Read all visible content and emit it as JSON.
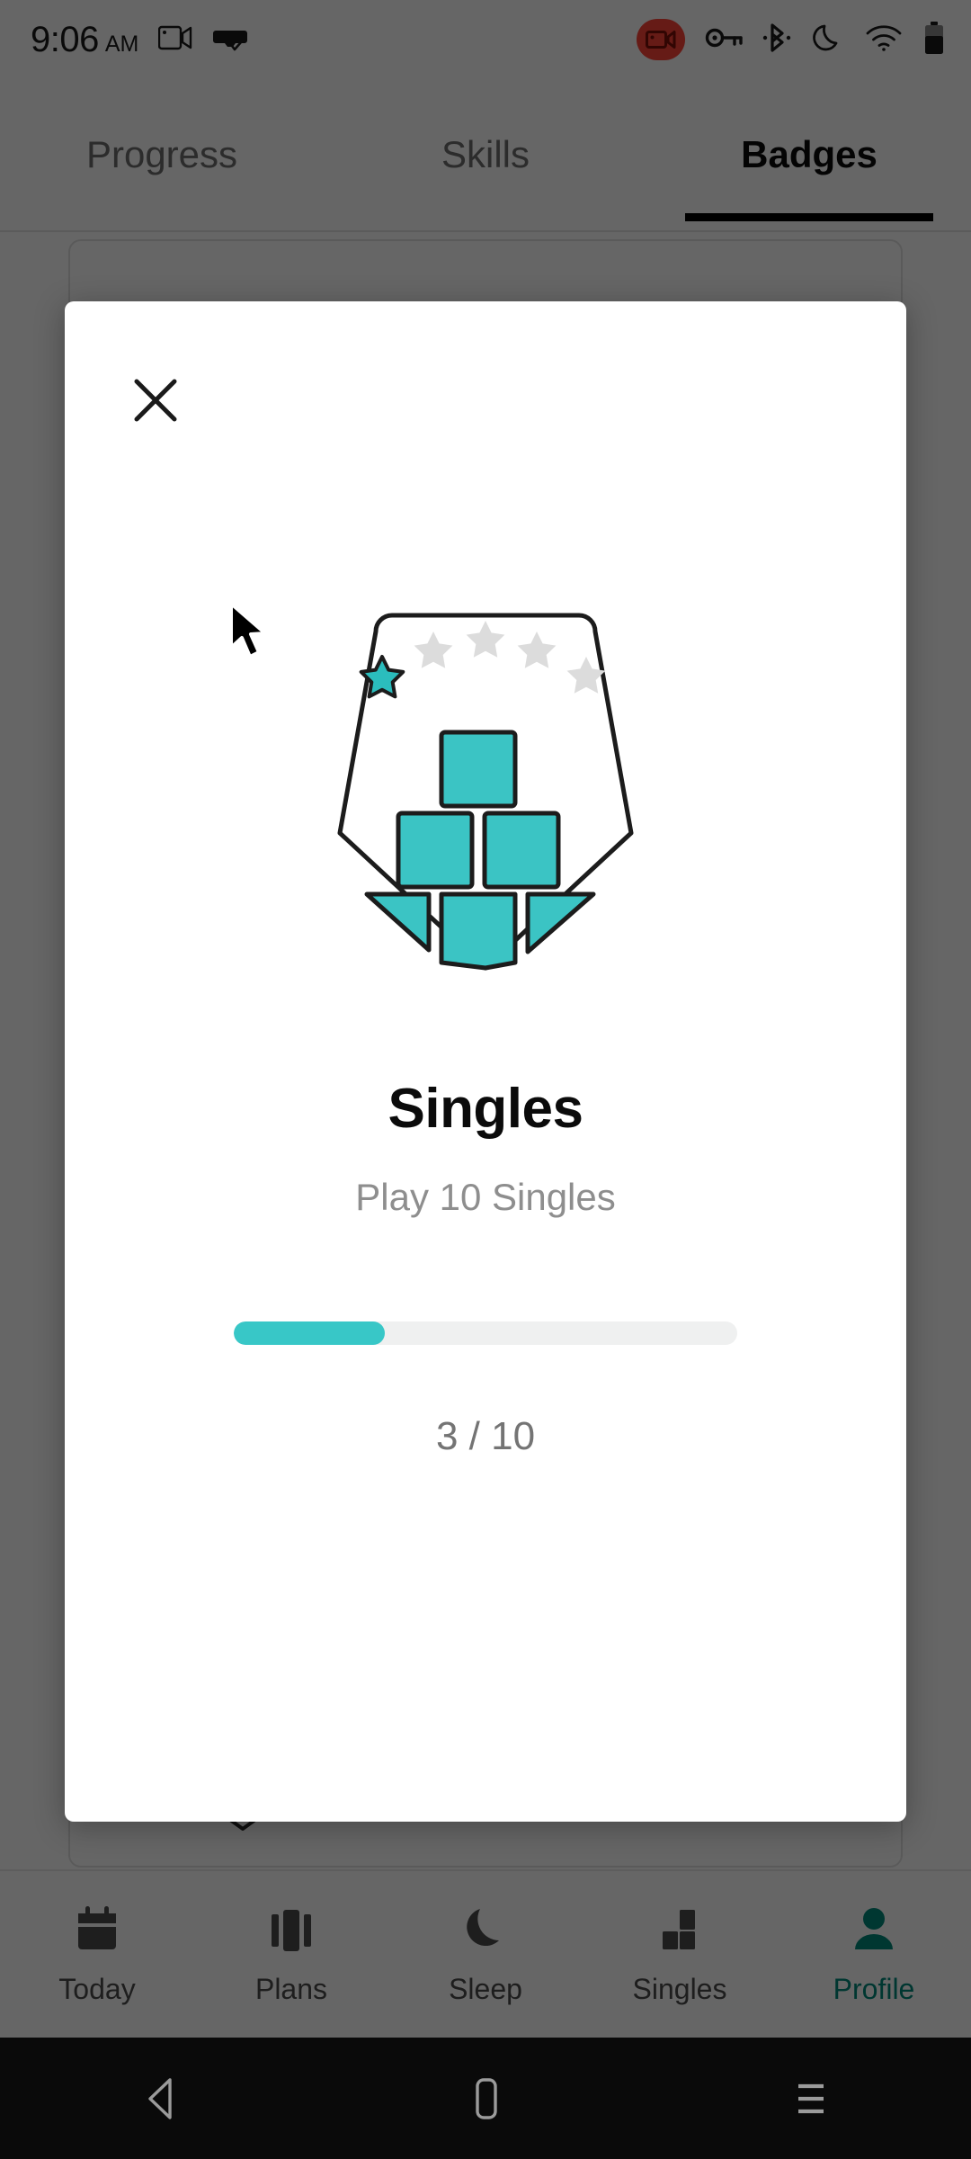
{
  "status_bar": {
    "time": "9:06",
    "meridiem": "AM",
    "icons_left": [
      "screen-cast-icon",
      "vr-headset-icon"
    ],
    "icons_right": [
      "screen-record-icon",
      "vpn-key-icon",
      "bluetooth-icon",
      "do-not-disturb-moon-icon",
      "wifi-icon",
      "battery-icon"
    ],
    "record_badge_color": "#ff4438"
  },
  "tabs": [
    {
      "label": "Progress",
      "active": false
    },
    {
      "label": "Skills",
      "active": false
    },
    {
      "label": "Badges",
      "active": true
    }
  ],
  "modal": {
    "close_icon": "close-icon",
    "badge_icon": "singles-shield-badge-icon",
    "title": "Singles",
    "subtitle": "Play 10 Singles",
    "progress": {
      "current": 3,
      "total": 10,
      "percent": 30,
      "label": "3 / 10",
      "fill_color": "#38c7c7",
      "track_color": "#eff0f0"
    },
    "stars": {
      "total": 5,
      "earned": 1,
      "earned_color": "#2bbdbd",
      "empty_color": "#dcdcdc"
    },
    "blocks_color": "#3bc4c4"
  },
  "bottom_nav": [
    {
      "label": "Today",
      "icon": "calendar-icon",
      "active": false
    },
    {
      "label": "Plans",
      "icon": "cards-icon",
      "active": false
    },
    {
      "label": "Sleep",
      "icon": "moon-icon",
      "active": false
    },
    {
      "label": "Singles",
      "icon": "blocks-icon",
      "active": false
    },
    {
      "label": "Profile",
      "icon": "person-icon",
      "active": true
    }
  ],
  "android_nav": {
    "back": "back-triangle-icon",
    "home": "home-square-icon",
    "recents": "recents-menu-icon"
  },
  "cursor": {
    "icon": "mouse-pointer-icon"
  },
  "colors": {
    "accent_teal": "#38c7c7",
    "nav_active": "#00897b"
  }
}
